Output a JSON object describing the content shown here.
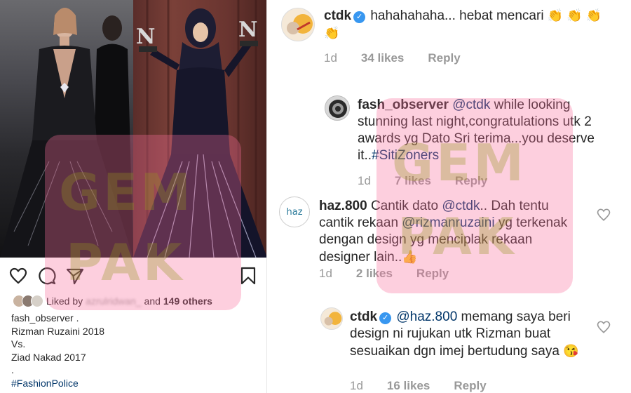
{
  "post": {
    "liked_by_label": "Liked by",
    "liked_by_user": "azrulridwan_",
    "liked_by_and": "and",
    "liked_by_count": "149 others",
    "author": "fash_observer",
    "caption_lines": [
      "Rizman Ruzaini 2018",
      "Vs.",
      "Ziad Nakad 2017",
      "."
    ],
    "hashtag": "#FashionPolice"
  },
  "comments": [
    {
      "user": "ctdk",
      "verified": true,
      "text": "hahahahaha... hebat mencari",
      "emoji": "👏 👏 👏 👏",
      "age": "1d",
      "likes": "34 likes",
      "reply": "Reply"
    },
    {
      "user": "fash_observer",
      "mention": "@ctdk",
      "text": " while looking stunning last night,congratulations utk 2 awards yg Dato Sri terima...you deserve it..",
      "hashtag": "#SitiZoners",
      "age": "1d",
      "likes": "7 likes",
      "reply": "Reply"
    },
    {
      "user": "haz.800",
      "text_a": "Cantik dato ",
      "mention_a": "@ctdk",
      "text_b": ".. Dah tentu cantik rekaan ",
      "mention_b": "@rizmanruzaini",
      "text_c": " yg terkenak dengan design yg menciplak rekaan designer lain..",
      "emoji": "👍",
      "age": "1d",
      "likes": "2 likes",
      "reply": "Reply"
    },
    {
      "user": "ctdk",
      "verified": true,
      "mention": "@haz.800",
      "text": " memang saya beri design ni  rujukan utk Rizman buat sesuaikan dgn imej bertudung saya",
      "emoji": "😘",
      "age": "1d",
      "likes": "16 likes",
      "reply": "Reply"
    }
  ],
  "watermark": {
    "line1": "GEM",
    "line2": "PAK"
  },
  "colors": {
    "link": "#003569",
    "verified": "#3897f0",
    "muted": "#999999",
    "watermark": "#fa6e9b"
  },
  "icons": [
    "heart-icon",
    "comment-icon",
    "share-icon",
    "bookmark-icon",
    "verified-icon"
  ]
}
